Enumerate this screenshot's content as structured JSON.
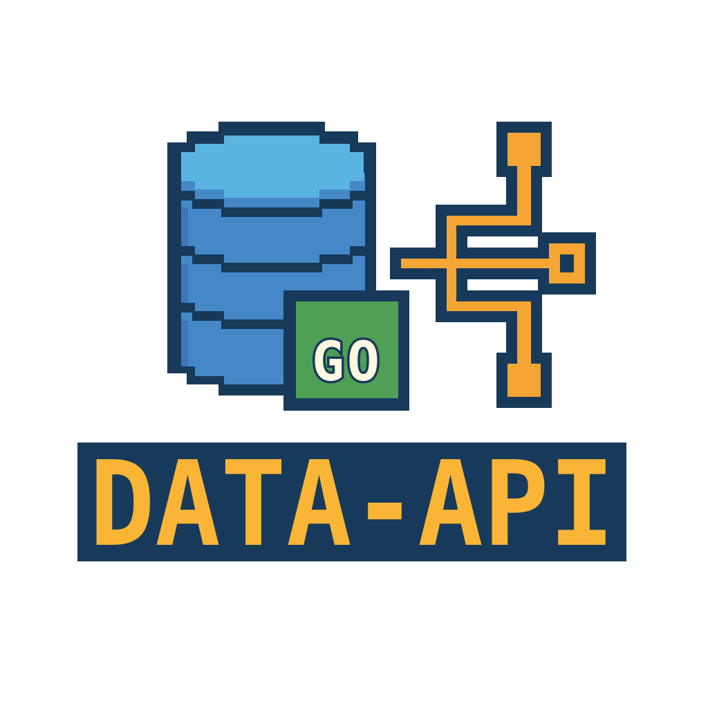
{
  "logo": {
    "badge_text": "GO",
    "wordmark": "DATA-API"
  },
  "icons": {
    "database": "database-icon",
    "network": "network-connector-icon",
    "badge": "go-badge-icon"
  },
  "colors": {
    "outline": "#173a5a",
    "db_top": "#5ab4e0",
    "db_body": "#4488c8",
    "db_shade": "#3a78b8",
    "badge_green": "#4f9f55",
    "badge_text": "#fdf8df",
    "connector_orange": "#f5a533",
    "wordmark_fill": "#fbb536",
    "background": "#ffffff"
  }
}
